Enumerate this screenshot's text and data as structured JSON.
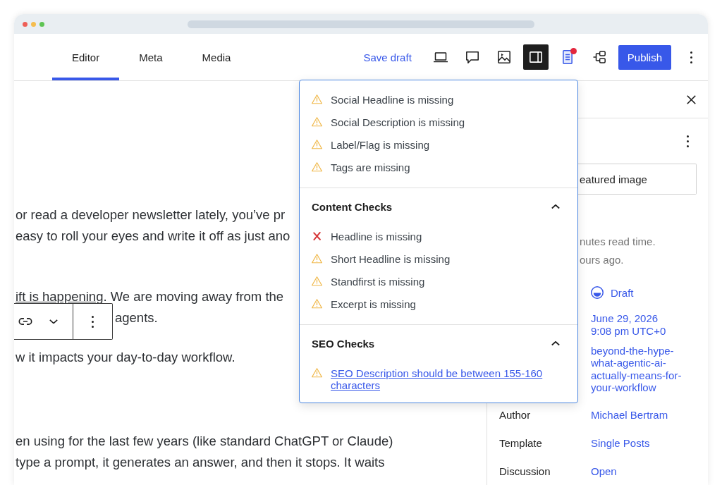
{
  "browser": {
    "dots": [
      {
        "color": "#ee5f57"
      },
      {
        "color": "#f5bd4f"
      },
      {
        "color": "#5fc454"
      }
    ]
  },
  "tabs": [
    {
      "label": "Editor",
      "selected": true
    },
    {
      "label": "Meta",
      "selected": false
    },
    {
      "label": "Media",
      "selected": false
    }
  ],
  "toolbar": {
    "save_draft": "Save draft",
    "tools": [
      {
        "kind": "laptop",
        "pressed": false,
        "notice": false
      },
      {
        "kind": "comment",
        "pressed": false,
        "notice": false
      },
      {
        "kind": "image",
        "pressed": false,
        "notice": false
      },
      {
        "kind": "sidebar",
        "pressed": true,
        "notice": false
      },
      {
        "kind": "document",
        "pressed": true,
        "notice": true
      },
      {
        "kind": "hierarchy",
        "pressed": false,
        "notice": false
      }
    ],
    "publish": "Publish"
  },
  "editor": {
    "paragraphs": [
      {
        "lines": [
          {
            "text": "or read a developer newsletter lately, you’ve pr"
          },
          {
            "text": "easy to roll your eyes and write it off as just ano"
          }
        ]
      },
      {
        "lines": [
          {
            "link": "ift is happening",
            "text": ". We are moving away from the"
          },
          {
            "text": "agents."
          }
        ]
      },
      {
        "lines": [
          {
            "text": "w it impacts your day-to-day workflow."
          }
        ]
      },
      {
        "lines": [
          {
            "text": "en using for the last few years (like standard ChatGPT or Claude)"
          },
          {
            "text": "type a prompt, it generates an answer, and then it stops. It waits"
          }
        ]
      }
    ]
  },
  "checks_popup": {
    "sections": [
      {
        "items": [
          {
            "kind": "warning",
            "text": "Social Headline is missing",
            "link": false
          },
          {
            "kind": "warning",
            "text": "Social Description is missing",
            "link": false
          },
          {
            "kind": "warning",
            "text": "Label/Flag is missing",
            "link": false
          },
          {
            "kind": "warning",
            "text": "Tags are missing",
            "link": false
          }
        ]
      },
      {
        "title": "Content Checks",
        "expanded": true,
        "items": [
          {
            "kind": "error",
            "text": "Headline is missing",
            "link": false
          },
          {
            "kind": "warning",
            "text": "Short Headline is missing",
            "link": false
          },
          {
            "kind": "warning",
            "text": "Standfirst is missing",
            "link": false
          },
          {
            "kind": "warning",
            "text": "Excerpt is missing",
            "link": false
          }
        ]
      },
      {
        "title": "SEO Checks",
        "expanded": true,
        "items": [
          {
            "kind": "warning",
            "text": "SEO Description should be between 155-160 characters",
            "link": true
          }
        ]
      }
    ]
  },
  "sidebar": {
    "featured_image": "eatured image",
    "read_time": "nutes read time.",
    "edited": "ours ago.",
    "rows": [
      {
        "kind": "status",
        "value": "Draft"
      },
      {
        "kind": "multiline",
        "lines": [
          "June 29, 2026",
          "9:08 pm UTC+0"
        ]
      },
      {
        "kind": "multiline",
        "lines": [
          "beyond-the-hype-",
          "what-agentic-ai-",
          "actually-means-for-",
          "your-workflow"
        ]
      },
      {
        "kind": "field",
        "label": "Author",
        "value": "Michael Bertram"
      },
      {
        "kind": "field",
        "label": "Template",
        "value": "Single Posts"
      },
      {
        "kind": "field",
        "label": "Discussion",
        "value": "Open"
      }
    ]
  }
}
